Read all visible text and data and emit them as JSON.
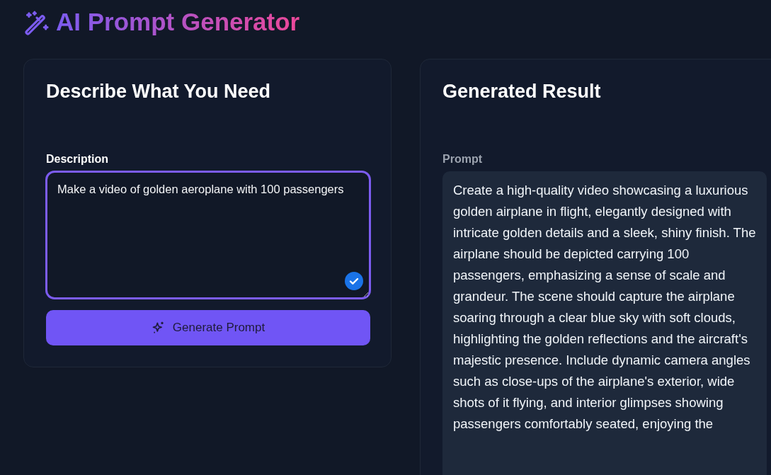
{
  "header": {
    "title": "AI Prompt Generator"
  },
  "input_card": {
    "heading": "Describe What You Need",
    "field_label": "Description",
    "description": "Make a video of golden aeroplane with 100 passengers",
    "focused": true,
    "button": "Generate Prompt"
  },
  "result_card": {
    "heading": "Generated Result",
    "field_label": "Prompt",
    "prompt": "Create a high-quality video showcasing a luxurious golden airplane in flight, elegantly designed with intricate golden details and a sleek, shiny finish. The airplane should be depicted carrying 100 passengers, emphasizing a sense of scale and grandeur. The scene should capture the airplane soaring through a clear blue sky with soft clouds, highlighting the golden reflections and the aircraft's majestic presence. Include dynamic camera angles such as close-ups of the airplane's exterior, wide shots of it flying, and interior glimpses showing passengers comfortably seated, enjoying the"
  }
}
